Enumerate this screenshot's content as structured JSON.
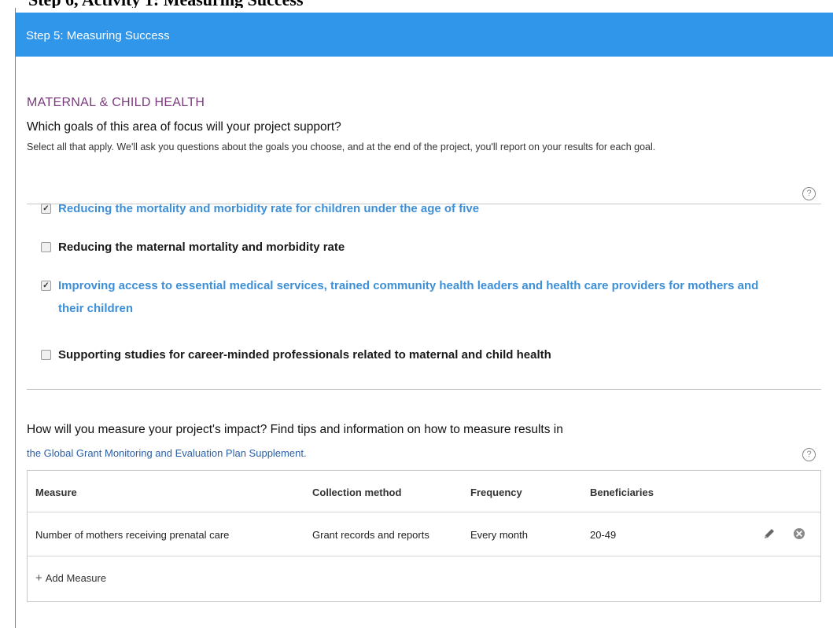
{
  "page": {
    "cropped_heading": "Step 6, Activity 1: Measuring Success",
    "step_title": "Step 5: Measuring Success"
  },
  "focus": {
    "area_title": "MATERNAL & CHILD HEALTH",
    "question": "Which goals of this area of focus will your project support?",
    "instructions": "Select all that apply. We'll ask you questions about the goals you choose, and at the end of the project, you'll report on your results for each goal."
  },
  "goals": [
    {
      "label": "Reducing the mortality and morbidity rate for children under the age of five",
      "checked": true
    },
    {
      "label": "Reducing the maternal mortality and morbidity rate",
      "checked": false
    },
    {
      "label": "Improving access to essential medical services, trained community health leaders and health care providers for mothers and their children",
      "checked": true
    },
    {
      "label": "Supporting studies for career-minded professionals related to maternal and child health",
      "checked": false
    }
  ],
  "measure": {
    "question": "How will you measure your project's impact? Find tips and information on how to measure results in",
    "link_text": "the Global Grant Monitoring and Evaluation Plan Supplement",
    "link_suffix": ".",
    "columns": [
      "Measure",
      "Collection method",
      "Frequency",
      "Beneficiaries"
    ],
    "rows": [
      [
        "Number of mothers receiving prenatal care",
        "Grant records and reports",
        "Every month",
        "20-49"
      ]
    ],
    "add_label": "Add Measure"
  },
  "icons": {
    "help": "help-icon",
    "edit": "pencil-icon",
    "delete": "close-circle-icon",
    "add": "plus-icon"
  },
  "colors": {
    "step_bar": "#2f96ea",
    "area_title": "#7a3a7d",
    "checked_goal": "#3d8fd8",
    "link": "#2a5fa8"
  },
  "glyphs": {
    "help": "?",
    "check": "✓",
    "plus": "+"
  }
}
